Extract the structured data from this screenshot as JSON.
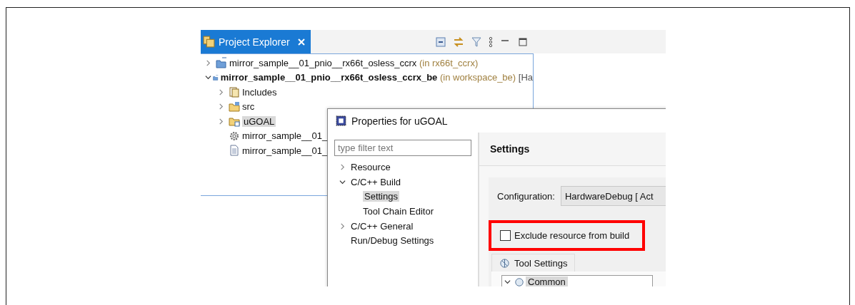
{
  "explorer": {
    "tab": {
      "label": "Project Explorer",
      "selected": true
    },
    "tree": [
      {
        "label": "mirror_sample__01_pnio__rx66t_osless_ccrx",
        "location": "(in rx66t_ccrx)",
        "active": false,
        "expanded": false
      },
      {
        "label": "mirror_sample__01_pnio__rx66t_osless_ccrx_be",
        "location": "(in workspace_be)",
        "note": "[Ha",
        "active": true,
        "expanded": true,
        "children": [
          {
            "label": "Includes",
            "kind": "includes",
            "expanded": false,
            "selected": false
          },
          {
            "label": "src",
            "kind": "source-folder",
            "expanded": false,
            "selected": false
          },
          {
            "label": "uGOAL",
            "kind": "folder",
            "expanded": false,
            "selected": true
          },
          {
            "label": "mirror_sample__01_",
            "kind": "settings-file",
            "selected": false
          },
          {
            "label": "mirror_sample__01_",
            "kind": "file",
            "selected": false
          }
        ]
      }
    ]
  },
  "dialog": {
    "title": "Properties for uGOAL",
    "filter": {
      "placeholder": "type filter text"
    },
    "nav": [
      {
        "label": "Resource",
        "kind": "branch",
        "expanded": false,
        "selected": false
      },
      {
        "label": "C/C++ Build",
        "kind": "branch",
        "expanded": true,
        "selected": false,
        "children": [
          {
            "label": "Settings",
            "selected": true
          },
          {
            "label": "Tool Chain Editor",
            "selected": false
          }
        ]
      },
      {
        "label": "C/C++ General",
        "kind": "branch",
        "expanded": false,
        "selected": false
      },
      {
        "label": "Run/Debug Settings",
        "kind": "leaf",
        "selected": false
      }
    ],
    "page": {
      "heading": "Settings",
      "configuration": {
        "label": "Configuration:",
        "value": "HardwareDebug  [ Act"
      },
      "exclude": {
        "label": "Exclude resource from build",
        "checked": false,
        "highlighted": true
      },
      "tabs": [
        {
          "label": "Tool Settings"
        }
      ],
      "tool_tree": [
        {
          "label": "Common",
          "expanded": true,
          "selected": true
        }
      ]
    }
  }
}
